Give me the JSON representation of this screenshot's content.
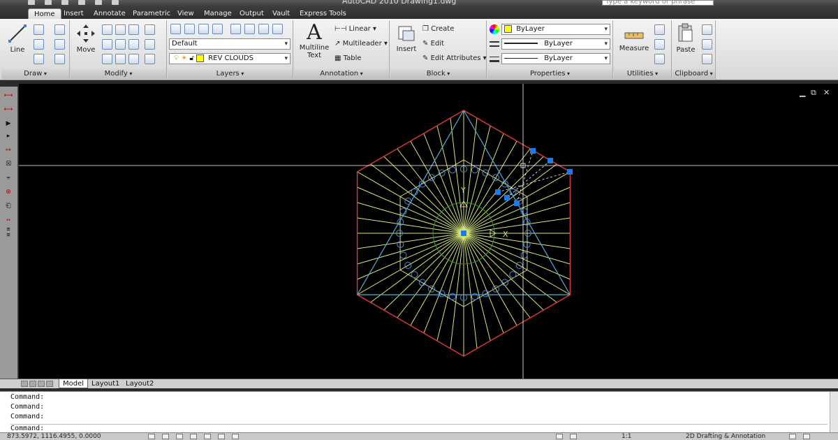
{
  "window": {
    "title": "AutoCAD 2010    Drawing1.dwg",
    "search_placeholder": "Type a keyword or phrase"
  },
  "tabs": [
    "Home",
    "Insert",
    "Annotate",
    "Parametric",
    "View",
    "Manage",
    "Output",
    "Vault",
    "Express Tools"
  ],
  "ribbon": {
    "draw": {
      "title": "Draw",
      "line_label": "Line"
    },
    "modify": {
      "title": "Modify",
      "move_label": "Move"
    },
    "layers": {
      "title": "Layers",
      "layer_state": "Default",
      "current_layer": "REV CLOUDS"
    },
    "annotation": {
      "title": "Annotation",
      "mtext_line1": "Multiline",
      "mtext_line2": "Text",
      "linear_label": "Linear",
      "multileader_label": "Multileader",
      "table_label": "Table"
    },
    "block": {
      "title": "Block",
      "insert_label": "Insert",
      "create_label": "Create",
      "edit_label": "Edit",
      "edit_attributes_label": "Edit Attributes"
    },
    "properties": {
      "title": "Properties",
      "color": "ByLayer",
      "linetype": "ByLayer",
      "lineweight": "ByLayer"
    },
    "utilities": {
      "title": "Utilities",
      "measure_label": "Measure"
    },
    "clipboard": {
      "title": "Clipboard",
      "paste_label": "Paste"
    }
  },
  "viewport": {
    "ucs_y_label": "Y",
    "ucs_x_label": "X"
  },
  "layout_tabs": [
    "Model",
    "Layout1",
    "Layout2"
  ],
  "command_lines": [
    "Command:",
    "Command:",
    "Command:",
    "Command:"
  ],
  "status": {
    "coordinates": "873.5972, 1116.4955, 0.0000",
    "scale": "1:1",
    "workspace": "2D Drafting & Annotation"
  },
  "colors": {
    "hexagon": "#e03a3a",
    "triangle": "#4fb0d8",
    "inner_hexagon": "#d8d890",
    "spokes": "#d9e87a",
    "circle_markers": "#4a90e0",
    "inner_circle": "#3a9a3a",
    "grip": "#1e7ae6",
    "crosshair": "#ffffff"
  }
}
